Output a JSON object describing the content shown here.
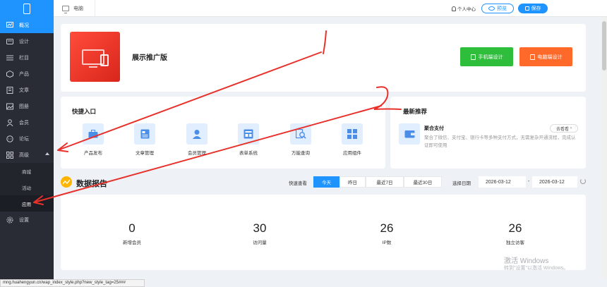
{
  "sidebar": {
    "items": [
      {
        "label": "概况",
        "icon": "chart-icon",
        "active": true
      },
      {
        "label": "设计",
        "icon": "palette-icon"
      },
      {
        "label": "栏目",
        "icon": "list-icon"
      },
      {
        "label": "产品",
        "icon": "cube-icon"
      },
      {
        "label": "文章",
        "icon": "article-icon"
      },
      {
        "label": "图册",
        "icon": "image-icon"
      },
      {
        "label": "会员",
        "icon": "user-icon"
      },
      {
        "label": "论坛",
        "icon": "chat-icon"
      },
      {
        "label": "高级",
        "icon": "grid-icon"
      }
    ],
    "subitems": [
      {
        "label": "商城"
      },
      {
        "label": "活动"
      },
      {
        "label": "应用"
      }
    ],
    "settings_label": "设置"
  },
  "topbar": {
    "tab_label": "电脑",
    "user_center": "个人中心",
    "preview_label": "预览",
    "save_label": "保存"
  },
  "preview": {
    "title": "展示推广版",
    "mobile_btn": "手机端设计",
    "pc_btn": "电脑端设计"
  },
  "quick": {
    "title": "快捷入口",
    "items": [
      {
        "label": "产品发布",
        "icon": "briefcase-icon"
      },
      {
        "label": "文章管理",
        "icon": "news-icon"
      },
      {
        "label": "会员管理",
        "icon": "user-icon"
      },
      {
        "label": "表单系统",
        "icon": "form-icon"
      },
      {
        "label": "万能查询",
        "icon": "search-doc-icon"
      },
      {
        "label": "应用组件",
        "icon": "grid-icon"
      }
    ]
  },
  "recommend": {
    "title": "最新推荐",
    "name": "聚合支付",
    "desc": "聚合了微信、支付宝、银行卡等多种支付方式，无需复杂开通流程，完成认证即可使用",
    "link": "去看看"
  },
  "report": {
    "title": "数据报告",
    "quick_label": "快速查看",
    "ranges": [
      "今天",
      "昨日",
      "最近7日",
      "最近30日"
    ],
    "active_range": "今天",
    "date_label": "选择日期",
    "start": "2026-03-12",
    "dash": "-",
    "end": "2026-03-12"
  },
  "stats": [
    {
      "value": "0",
      "label": "新增会员"
    },
    {
      "value": "30",
      "label": "访问量"
    },
    {
      "value": "26",
      "label": "IP数"
    },
    {
      "value": "26",
      "label": "独立访客"
    }
  ],
  "watermark": {
    "line1": "激活 Windows",
    "line2": "转到\"设置\"以激活 Windows。"
  },
  "status_url": "mng.huahengyun.cn/wap_index_style.php?new_style_tag=25###",
  "colors": {
    "accent": "#1f93fe",
    "sidebar": "#2a2c35",
    "green": "#2fbe3c",
    "orange": "#ff6a2b",
    "annotation": "#e8312a"
  }
}
